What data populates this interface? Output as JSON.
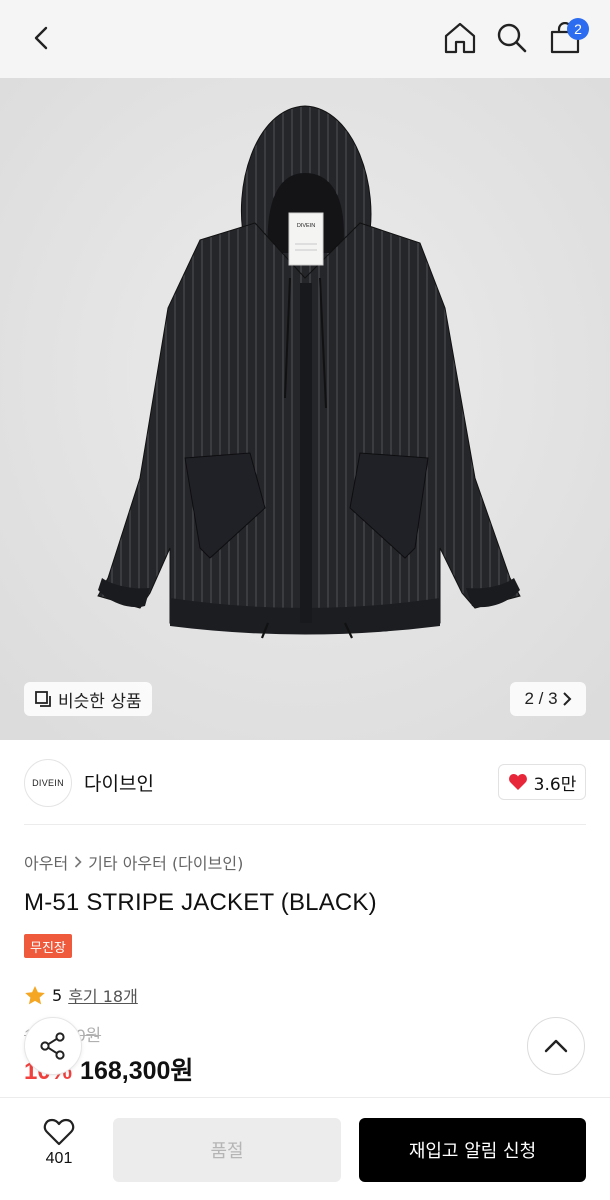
{
  "header": {
    "cart_count": "2"
  },
  "hero": {
    "similar_label": "비슷한 상품",
    "pager": "2 / 3",
    "label_tag": "DIVEIN"
  },
  "brand": {
    "logo_text": "DIVEIN",
    "name": "다이브인",
    "likes": "3.6만"
  },
  "product": {
    "breadcrumb": [
      "아우터",
      "기타 아우터 (다이브인)"
    ],
    "title": "M-51 STRIPE JACKET (BLACK)",
    "tag": "무진장",
    "rating": "5",
    "reviews": "후기 18개",
    "original_price": "187,000원",
    "discount": "10%",
    "price": "168,300원"
  },
  "bottom": {
    "wish_count": "401",
    "soldout_label": "품절",
    "restock_label": "재입고 알림 신청"
  },
  "colors": {
    "accent_red": "#f0413e",
    "badge_blue": "#2b6cf0",
    "tag_orange": "#ef5a3c"
  }
}
